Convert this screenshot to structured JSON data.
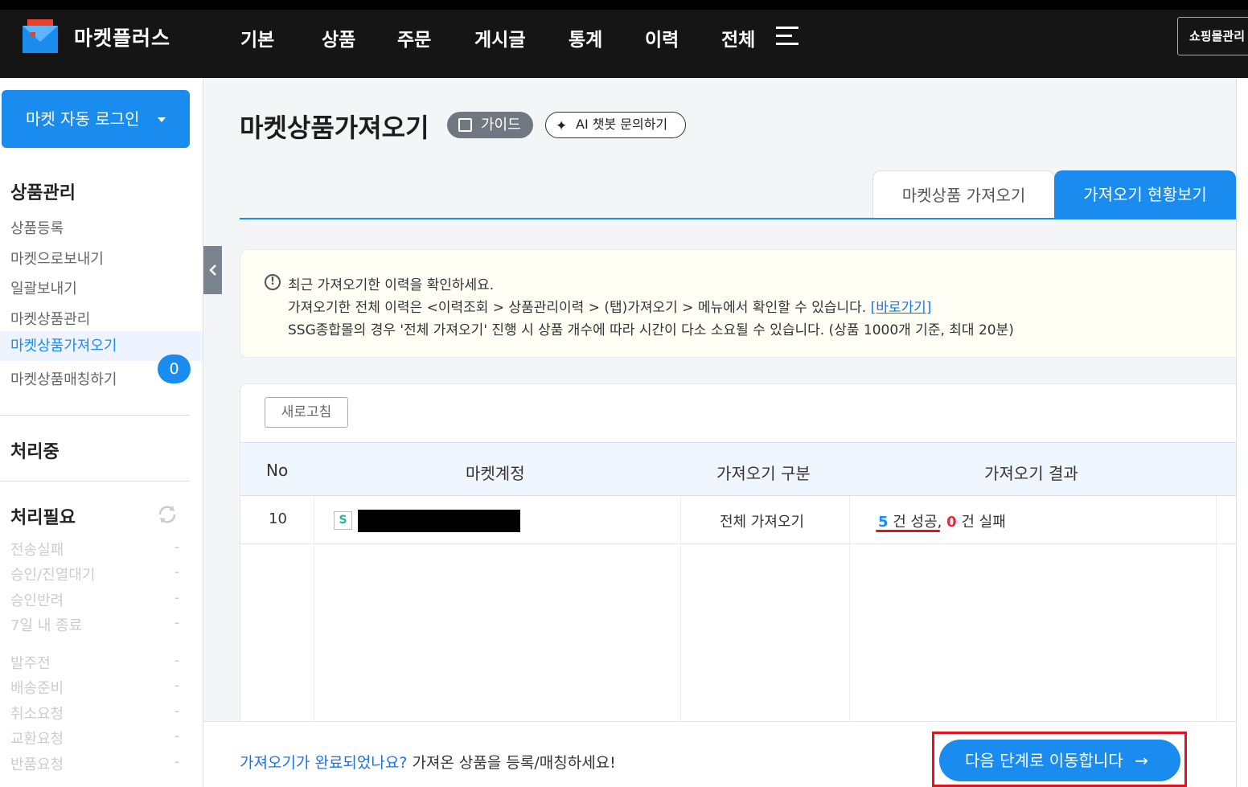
{
  "topbar": {
    "brand": "마켓플러스",
    "nav": [
      "기본",
      "상품",
      "주문",
      "게시글",
      "통계",
      "이력",
      "전체"
    ],
    "shop_admin": "쇼핑몰관리"
  },
  "sidebar": {
    "auto_login": "마켓 자동 로그인",
    "product_section": "상품관리",
    "product_links": [
      "상품등록",
      "마켓으로보내기",
      "일괄보내기",
      "마켓상품관리",
      "마켓상품가져오기",
      "마켓상품매칭하기"
    ],
    "active_link_index": 4,
    "processing_label": "처리중",
    "processing_count": "0",
    "needs_action_label": "처리필요",
    "stats_group1": [
      {
        "label": "전송실패",
        "value": "-"
      },
      {
        "label": "승인/진열대기",
        "value": "-"
      },
      {
        "label": "승인반려",
        "value": "-"
      },
      {
        "label": "7일 내 종료",
        "value": "-"
      }
    ],
    "stats_group2": [
      {
        "label": "발주전",
        "value": "-"
      },
      {
        "label": "배송준비",
        "value": "-"
      },
      {
        "label": "취소요청",
        "value": "-"
      },
      {
        "label": "교환요청",
        "value": "-"
      },
      {
        "label": "반품요청",
        "value": "-"
      }
    ]
  },
  "main": {
    "title": "마켓상품가져오기",
    "guide_label": "가이드",
    "ai_label": "AI 챗봇 문의하기",
    "tabs": [
      {
        "label": "마켓상품 가져오기",
        "active": false
      },
      {
        "label": "가져오기 현황보기",
        "active": true
      }
    ],
    "notice": {
      "line1": "최근 가져오기한 이력을 확인하세요.",
      "line2": "가져오기한 전체 이력은 <이력조회 > 상품관리이력 > (탭)가져오기 > 메뉴에서 확인할 수 있습니다.",
      "line2_link": "[바로가기]",
      "line3": "SSG종합몰의 경우 '전체 가져오기' 진행 시 상품 개수에 따라 시간이 다소 소요될 수 있습니다. (상품 1000개 기준, 최대 20분)"
    },
    "refresh_label": "새로고침",
    "table": {
      "headers": [
        "No",
        "마켓계정",
        "가져오기 구분",
        "가져오기 결과"
      ],
      "rows": [
        {
          "no": "10",
          "market_logo": "S",
          "type": "전체 가져오기",
          "success_count": "5",
          "success_text": " 건 성공,",
          "fail_count": "0",
          "fail_text": " 건 실패"
        }
      ]
    }
  },
  "footer": {
    "question": "가져오기가 완료되었나요?",
    "hint": " 가져온 상품을 등록/매칭하세요!",
    "next_label": "다음 단계로 이동합니다",
    "next_arrow": "→"
  },
  "colors": {
    "accent": "#1a8cf0",
    "topbar": "#151515",
    "success": "#1a8cf0",
    "fail": "#e8283c",
    "highlight": "#e2121e"
  }
}
